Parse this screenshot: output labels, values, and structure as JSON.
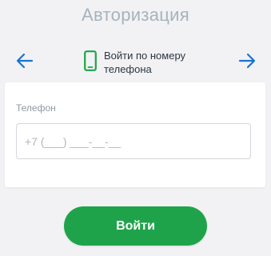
{
  "header": {
    "title": "Авторизация"
  },
  "method_switcher": {
    "prev_icon": "arrow-left-icon",
    "next_icon": "arrow-right-icon",
    "method_icon": "smartphone-icon",
    "method_label": "Войти по номеру телефона"
  },
  "form": {
    "phone_label": "Телефон",
    "phone_value": "",
    "phone_placeholder": "+7 (___) ___-__-__"
  },
  "actions": {
    "submit_label": "Войти"
  },
  "colors": {
    "accent_blue": "#1a73d4",
    "brand_green": "#1fa34a",
    "title_gray": "#a7b3bd",
    "background": "#f2f2f4"
  }
}
